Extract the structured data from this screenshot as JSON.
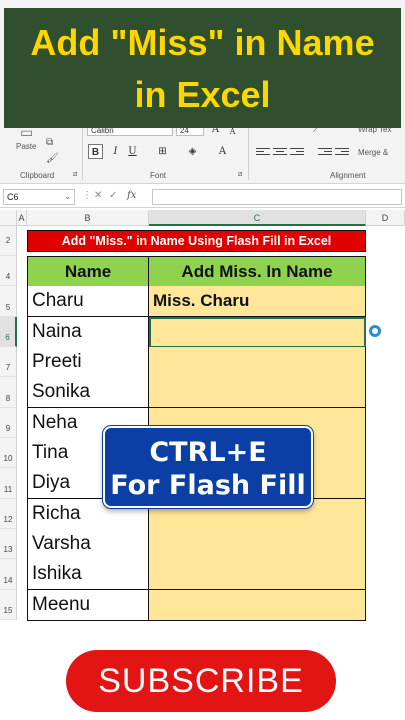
{
  "banner": {
    "line1": "Add \"Miss\" in Name",
    "line2": "in Excel"
  },
  "ribbon": {
    "paste_label": "Paste",
    "font_name": "Calibri",
    "font_size": "24",
    "grow_font": "A",
    "shrink_font": "A",
    "bold": "B",
    "italic": "I",
    "underline": "U",
    "font_color": "A",
    "wrap_text": "Wrap Tex",
    "merge": "Merge &",
    "group_clipboard": "Clipboard",
    "group_font": "Font",
    "group_alignment": "Alignment"
  },
  "formula_bar": {
    "name_box": "C6",
    "fx": "fx",
    "value": ""
  },
  "columns": [
    "A",
    "B",
    "C",
    "D"
  ],
  "rows": [
    "2",
    "4",
    "5",
    "6",
    "7",
    "8",
    "9",
    "10",
    "11",
    "12",
    "13",
    "14",
    "15"
  ],
  "sheet": {
    "title": "Add \"Miss.\" in Name Using Flash Fill in Excel",
    "header_name": "Name",
    "header_result": "Add Miss. In Name",
    "names": [
      "Charu",
      "Naina",
      "Preeti",
      "Sonika",
      "Neha",
      "Tina",
      "Diya",
      "Richa",
      "Varsha",
      "Ishika",
      "Meenu"
    ],
    "results": [
      "Miss. Charu",
      "",
      "",
      "",
      "",
      "",
      "",
      "",
      "",
      "",
      ""
    ]
  },
  "overlay": {
    "line1": "CTRL+E",
    "line2": "For Flash Fill"
  },
  "subscribe": {
    "label": "SUBSCRIBE"
  },
  "colors": {
    "title_red": "#e00000",
    "header_green": "#8ed24e",
    "result_yellow": "#ffe699",
    "overlay_blue": "#0b3fa6",
    "subscribe_red": "#e31414",
    "banner_green": "#2f4f2f",
    "banner_text": "#ffd700"
  }
}
